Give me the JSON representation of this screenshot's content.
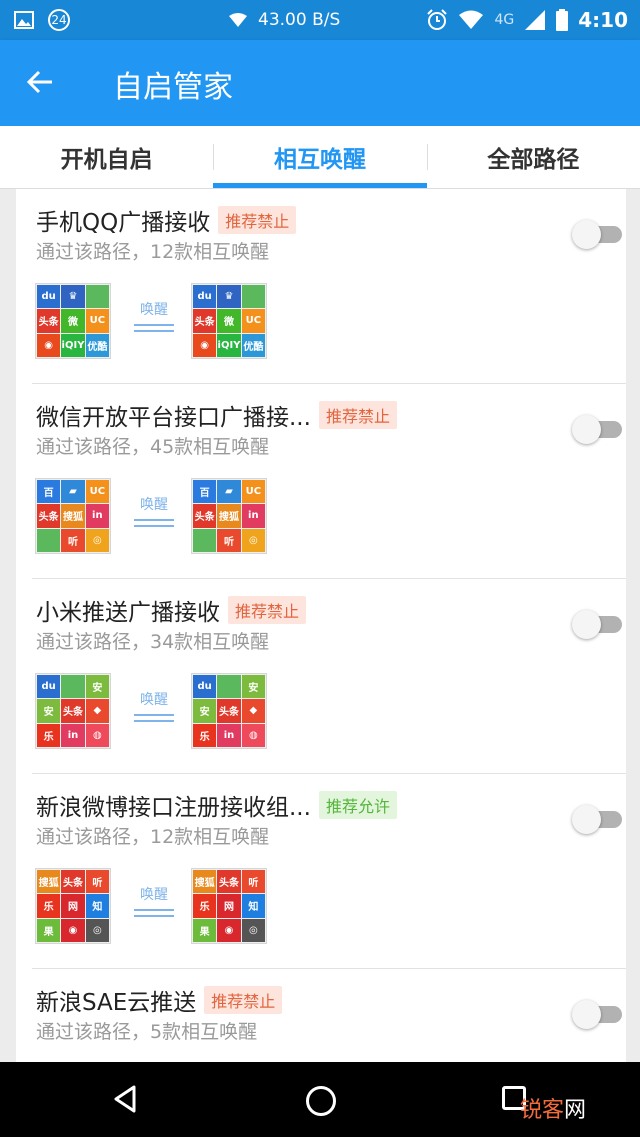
{
  "status_bar": {
    "notif_count": "24",
    "speed": "43.00 B/S",
    "network": "4G",
    "time": "4:10"
  },
  "app_bar": {
    "title": "自启管家"
  },
  "tabs": [
    {
      "label": "开机自启",
      "active": false
    },
    {
      "label": "相互唤醒",
      "active": true
    },
    {
      "label": "全部路径",
      "active": false
    }
  ],
  "items": [
    {
      "title": "手机QQ广播接收",
      "badge": "推荐禁止",
      "badge_type": "forbid",
      "subtitle": "通过该路径，12款相互唤醒",
      "wake_label": "唤醒",
      "enabled": false
    },
    {
      "title": "微信开放平台接口广播接...",
      "badge": "推荐禁止",
      "badge_type": "forbid",
      "subtitle": "通过该路径，45款相互唤醒",
      "wake_label": "唤醒",
      "enabled": false
    },
    {
      "title": "小米推送广播接收",
      "badge": "推荐禁止",
      "badge_type": "forbid",
      "subtitle": "通过该路径，34款相互唤醒",
      "wake_label": "唤醒",
      "enabled": false
    },
    {
      "title": "新浪微博接口注册接收组...",
      "badge": "推荐允许",
      "badge_type": "allow",
      "subtitle": "通过该路径，12款相互唤醒",
      "wake_label": "唤醒",
      "enabled": false
    },
    {
      "title": "新浪SAE云推送",
      "badge": "推荐禁止",
      "badge_type": "forbid",
      "subtitle": "通过该路径，5款相互唤醒",
      "wake_label": "唤醒",
      "enabled": false
    }
  ],
  "app_icons": [
    [
      {
        "t": "du",
        "c": "#2a6fd0"
      },
      {
        "t": "♛",
        "c": "#2f64c2"
      },
      {
        "t": "",
        "c": "#5cb85c"
      },
      {
        "t": "头条",
        "c": "#e0392b"
      },
      {
        "t": "微",
        "c": "#42b72a"
      },
      {
        "t": "UC",
        "c": "#f3911c"
      },
      {
        "t": "◉",
        "c": "#e8491d"
      },
      {
        "t": "iQIY",
        "c": "#28b540"
      },
      {
        "t": "优酷",
        "c": "#2c98d8"
      }
    ],
    [
      {
        "t": "百",
        "c": "#2a7ae0"
      },
      {
        "t": "▰",
        "c": "#2f88d8"
      },
      {
        "t": "UC",
        "c": "#f3911c"
      },
      {
        "t": "头条",
        "c": "#e0392b"
      },
      {
        "t": "搜狐",
        "c": "#e8891d"
      },
      {
        "t": "in",
        "c": "#e23b61"
      },
      {
        "t": "",
        "c": "#5cb85c"
      },
      {
        "t": "听",
        "c": "#e94a2d"
      },
      {
        "t": "◎",
        "c": "#f0a31c"
      }
    ],
    [
      {
        "t": "du",
        "c": "#2a6fd0"
      },
      {
        "t": "",
        "c": "#5cb85c"
      },
      {
        "t": "安",
        "c": "#7dbb3f"
      },
      {
        "t": "安",
        "c": "#7dbb3f"
      },
      {
        "t": "头条",
        "c": "#e0392b"
      },
      {
        "t": "◆",
        "c": "#e94a2d"
      },
      {
        "t": "乐",
        "c": "#e8341f"
      },
      {
        "t": "in",
        "c": "#e23b61"
      },
      {
        "t": "◍",
        "c": "#ef4a5c"
      }
    ],
    [
      {
        "t": "搜狐",
        "c": "#e8891d"
      },
      {
        "t": "头条",
        "c": "#e0392b"
      },
      {
        "t": "听",
        "c": "#e94a2d"
      },
      {
        "t": "乐",
        "c": "#e8341f"
      },
      {
        "t": "网",
        "c": "#d8282e"
      },
      {
        "t": "知",
        "c": "#1f7fe0"
      },
      {
        "t": "果",
        "c": "#6cbb3a"
      },
      {
        "t": "◉",
        "c": "#d8282e"
      },
      {
        "t": "◎",
        "c": "#555555"
      }
    ],
    [
      {
        "t": "",
        "c": "#e6e6e6"
      },
      {
        "t": "",
        "c": "#e6e6e6"
      },
      {
        "t": "",
        "c": "#e6e6e6"
      },
      {
        "t": "",
        "c": "#e6e6e6"
      },
      {
        "t": "",
        "c": "#e6e6e6"
      },
      {
        "t": "",
        "c": "#e6e6e6"
      },
      {
        "t": "",
        "c": "#e6e6e6"
      },
      {
        "t": "",
        "c": "#e6e6e6"
      },
      {
        "t": "",
        "c": "#e6e6e6"
      }
    ]
  ],
  "watermark": {
    "part1": "锐客",
    "part2": "网"
  },
  "colors": {
    "status_bar": "#1787d6",
    "app_bar": "#2196f3",
    "accent": "#2196f3",
    "forbid": "#e2653f",
    "allow": "#56b53b"
  }
}
